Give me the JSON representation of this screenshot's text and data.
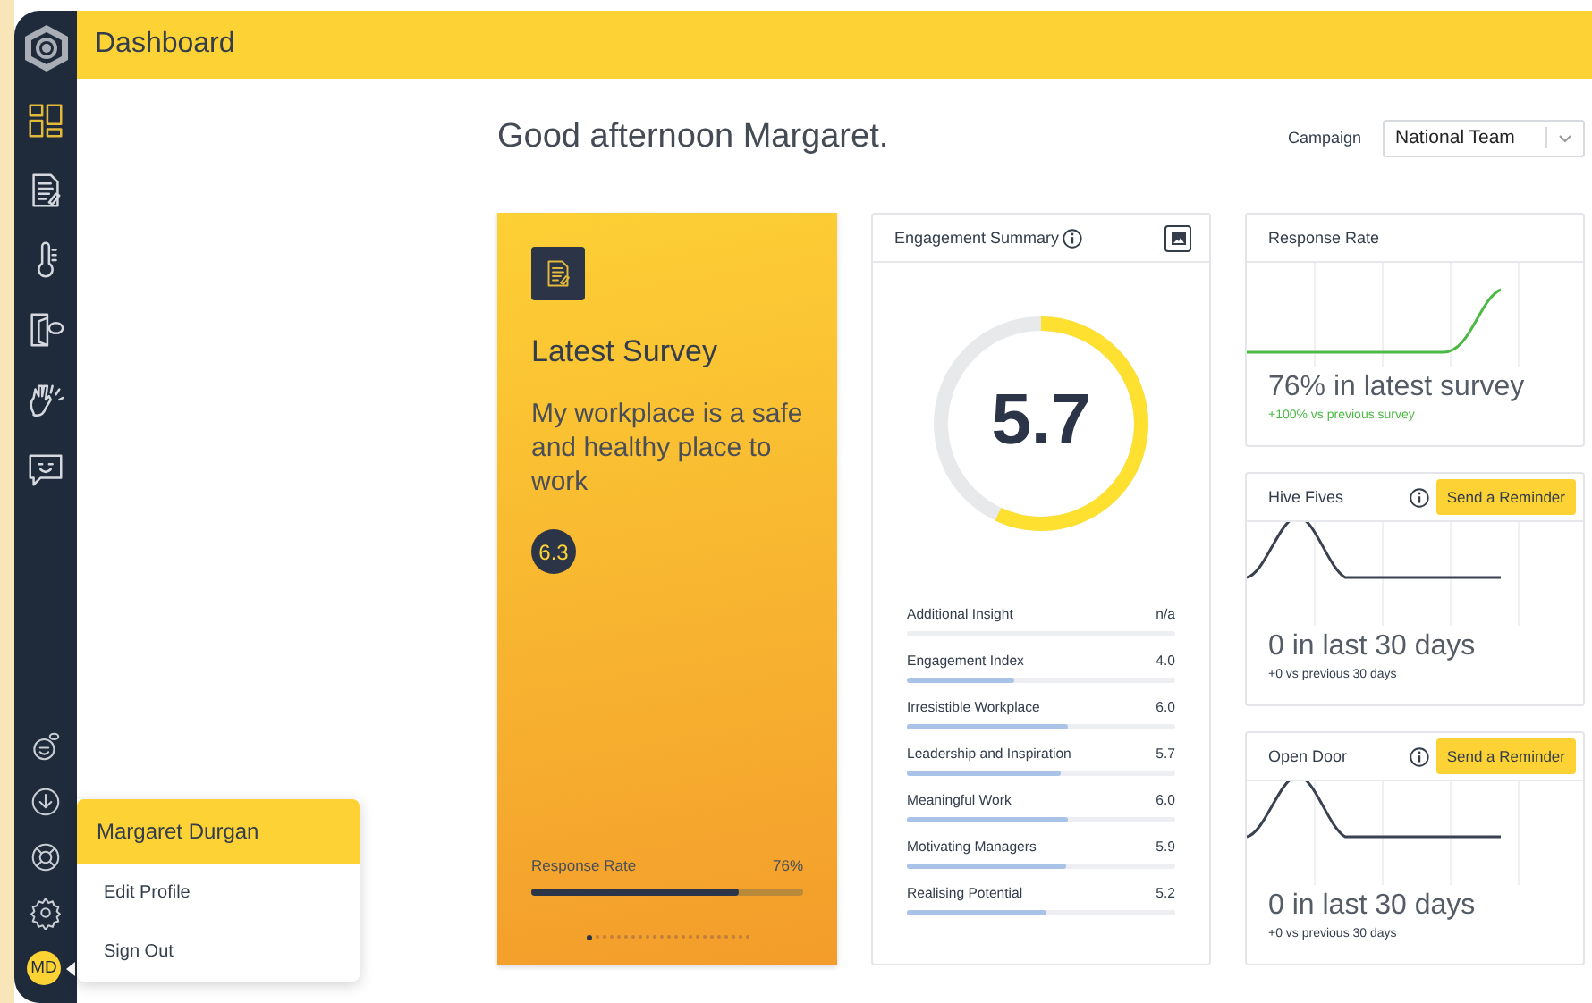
{
  "header": {
    "title": "Dashboard"
  },
  "sidebar": {
    "items": [
      {
        "kind": "dashboard",
        "selected": true
      },
      {
        "kind": "survey",
        "selected": false
      },
      {
        "kind": "thermometer",
        "selected": false
      },
      {
        "kind": "door",
        "selected": false
      },
      {
        "kind": "hands",
        "selected": false
      },
      {
        "kind": "chat",
        "selected": false
      }
    ],
    "bottom_items": [
      {
        "kind": "bot"
      },
      {
        "kind": "download"
      },
      {
        "kind": "help"
      },
      {
        "kind": "settings"
      }
    ],
    "avatar": {
      "initials": "MD"
    }
  },
  "user_menu": {
    "name": "Margaret Durgan",
    "items": [
      "Edit Profile",
      "Sign Out"
    ]
  },
  "greeting": "Good afternoon Margaret.",
  "campaign": {
    "label": "Campaign",
    "value": "National Team"
  },
  "latest_survey": {
    "title": "Latest Survey",
    "question": "My workplace is a safe and healthy place to work",
    "score": "6.3",
    "response_label": "Response Rate",
    "response_value": "76%",
    "level": 0.76,
    "pages": [
      {
        "selected": true
      },
      {
        "selected": false
      },
      {
        "selected": false
      },
      {
        "selected": false
      },
      {
        "selected": false
      },
      {
        "selected": false
      },
      {
        "selected": false
      },
      {
        "selected": false
      },
      {
        "selected": false
      },
      {
        "selected": false
      },
      {
        "selected": false
      },
      {
        "selected": false
      },
      {
        "selected": false
      },
      {
        "selected": false
      },
      {
        "selected": false
      },
      {
        "selected": false
      },
      {
        "selected": false
      },
      {
        "selected": false
      },
      {
        "selected": false
      },
      {
        "selected": false
      },
      {
        "selected": false
      },
      {
        "selected": false
      },
      {
        "selected": false
      }
    ]
  },
  "engagement": {
    "title": "Engagement Summary",
    "score": "5.7",
    "level": 0.57,
    "metrics": [
      {
        "name": "Additional Insight",
        "value": "n/a"
      },
      {
        "name": "Engagement Index",
        "value": "4.0",
        "level": 0.4
      },
      {
        "name": "Irresistible Workplace",
        "value": "6.0",
        "level": 0.6
      },
      {
        "name": "Leadership and Inspiration",
        "value": "5.7",
        "level": 0.57
      },
      {
        "name": "Meaningful Work",
        "value": "6.0",
        "level": 0.6
      },
      {
        "name": "Motivating Managers",
        "value": "5.9",
        "level": 0.59
      },
      {
        "name": "Realising Potential",
        "value": "5.2",
        "level": 0.52
      }
    ]
  },
  "stat_cards": [
    {
      "kind": "rise",
      "title": "Response Rate",
      "headline": "76% in latest survey",
      "change": "+100% vs previous survey"
    },
    {
      "kind": "bump",
      "title": "Hive Fives",
      "button": "Send a Reminder",
      "headline": "0 in last 30 days",
      "change": "+0 vs previous 30 days"
    },
    {
      "kind": "bump",
      "title": "Open Door",
      "button": "Send a Reminder",
      "headline": "0 in last 30 days",
      "change": "+0 vs previous 30 days"
    }
  ]
}
